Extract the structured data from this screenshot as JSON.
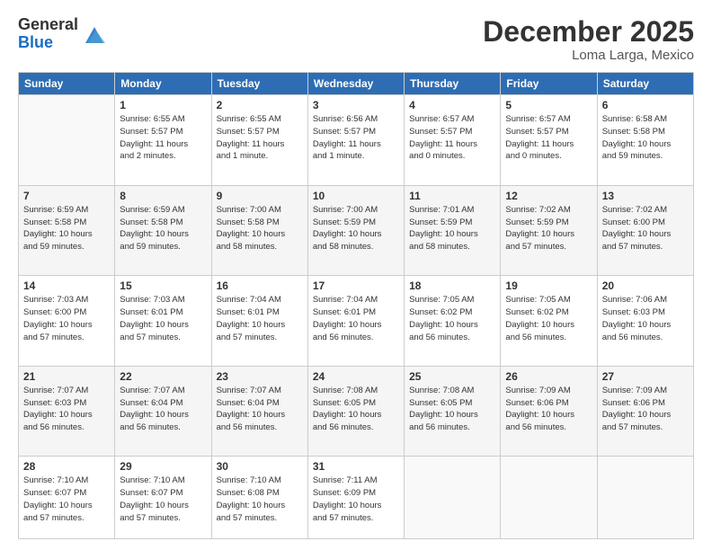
{
  "header": {
    "logo_general": "General",
    "logo_blue": "Blue",
    "month_title": "December 2025",
    "location": "Loma Larga, Mexico"
  },
  "days_of_week": [
    "Sunday",
    "Monday",
    "Tuesday",
    "Wednesday",
    "Thursday",
    "Friday",
    "Saturday"
  ],
  "weeks": [
    [
      {
        "day": "",
        "info": ""
      },
      {
        "day": "1",
        "info": "Sunrise: 6:55 AM\nSunset: 5:57 PM\nDaylight: 11 hours\nand 2 minutes."
      },
      {
        "day": "2",
        "info": "Sunrise: 6:55 AM\nSunset: 5:57 PM\nDaylight: 11 hours\nand 1 minute."
      },
      {
        "day": "3",
        "info": "Sunrise: 6:56 AM\nSunset: 5:57 PM\nDaylight: 11 hours\nand 1 minute."
      },
      {
        "day": "4",
        "info": "Sunrise: 6:57 AM\nSunset: 5:57 PM\nDaylight: 11 hours\nand 0 minutes."
      },
      {
        "day": "5",
        "info": "Sunrise: 6:57 AM\nSunset: 5:57 PM\nDaylight: 11 hours\nand 0 minutes."
      },
      {
        "day": "6",
        "info": "Sunrise: 6:58 AM\nSunset: 5:58 PM\nDaylight: 10 hours\nand 59 minutes."
      }
    ],
    [
      {
        "day": "7",
        "info": "Sunrise: 6:59 AM\nSunset: 5:58 PM\nDaylight: 10 hours\nand 59 minutes."
      },
      {
        "day": "8",
        "info": "Sunrise: 6:59 AM\nSunset: 5:58 PM\nDaylight: 10 hours\nand 59 minutes."
      },
      {
        "day": "9",
        "info": "Sunrise: 7:00 AM\nSunset: 5:58 PM\nDaylight: 10 hours\nand 58 minutes."
      },
      {
        "day": "10",
        "info": "Sunrise: 7:00 AM\nSunset: 5:59 PM\nDaylight: 10 hours\nand 58 minutes."
      },
      {
        "day": "11",
        "info": "Sunrise: 7:01 AM\nSunset: 5:59 PM\nDaylight: 10 hours\nand 58 minutes."
      },
      {
        "day": "12",
        "info": "Sunrise: 7:02 AM\nSunset: 5:59 PM\nDaylight: 10 hours\nand 57 minutes."
      },
      {
        "day": "13",
        "info": "Sunrise: 7:02 AM\nSunset: 6:00 PM\nDaylight: 10 hours\nand 57 minutes."
      }
    ],
    [
      {
        "day": "14",
        "info": "Sunrise: 7:03 AM\nSunset: 6:00 PM\nDaylight: 10 hours\nand 57 minutes."
      },
      {
        "day": "15",
        "info": "Sunrise: 7:03 AM\nSunset: 6:01 PM\nDaylight: 10 hours\nand 57 minutes."
      },
      {
        "day": "16",
        "info": "Sunrise: 7:04 AM\nSunset: 6:01 PM\nDaylight: 10 hours\nand 57 minutes."
      },
      {
        "day": "17",
        "info": "Sunrise: 7:04 AM\nSunset: 6:01 PM\nDaylight: 10 hours\nand 56 minutes."
      },
      {
        "day": "18",
        "info": "Sunrise: 7:05 AM\nSunset: 6:02 PM\nDaylight: 10 hours\nand 56 minutes."
      },
      {
        "day": "19",
        "info": "Sunrise: 7:05 AM\nSunset: 6:02 PM\nDaylight: 10 hours\nand 56 minutes."
      },
      {
        "day": "20",
        "info": "Sunrise: 7:06 AM\nSunset: 6:03 PM\nDaylight: 10 hours\nand 56 minutes."
      }
    ],
    [
      {
        "day": "21",
        "info": "Sunrise: 7:07 AM\nSunset: 6:03 PM\nDaylight: 10 hours\nand 56 minutes."
      },
      {
        "day": "22",
        "info": "Sunrise: 7:07 AM\nSunset: 6:04 PM\nDaylight: 10 hours\nand 56 minutes."
      },
      {
        "day": "23",
        "info": "Sunrise: 7:07 AM\nSunset: 6:04 PM\nDaylight: 10 hours\nand 56 minutes."
      },
      {
        "day": "24",
        "info": "Sunrise: 7:08 AM\nSunset: 6:05 PM\nDaylight: 10 hours\nand 56 minutes."
      },
      {
        "day": "25",
        "info": "Sunrise: 7:08 AM\nSunset: 6:05 PM\nDaylight: 10 hours\nand 56 minutes."
      },
      {
        "day": "26",
        "info": "Sunrise: 7:09 AM\nSunset: 6:06 PM\nDaylight: 10 hours\nand 56 minutes."
      },
      {
        "day": "27",
        "info": "Sunrise: 7:09 AM\nSunset: 6:06 PM\nDaylight: 10 hours\nand 57 minutes."
      }
    ],
    [
      {
        "day": "28",
        "info": "Sunrise: 7:10 AM\nSunset: 6:07 PM\nDaylight: 10 hours\nand 57 minutes."
      },
      {
        "day": "29",
        "info": "Sunrise: 7:10 AM\nSunset: 6:07 PM\nDaylight: 10 hours\nand 57 minutes."
      },
      {
        "day": "30",
        "info": "Sunrise: 7:10 AM\nSunset: 6:08 PM\nDaylight: 10 hours\nand 57 minutes."
      },
      {
        "day": "31",
        "info": "Sunrise: 7:11 AM\nSunset: 6:09 PM\nDaylight: 10 hours\nand 57 minutes."
      },
      {
        "day": "",
        "info": ""
      },
      {
        "day": "",
        "info": ""
      },
      {
        "day": "",
        "info": ""
      }
    ]
  ]
}
